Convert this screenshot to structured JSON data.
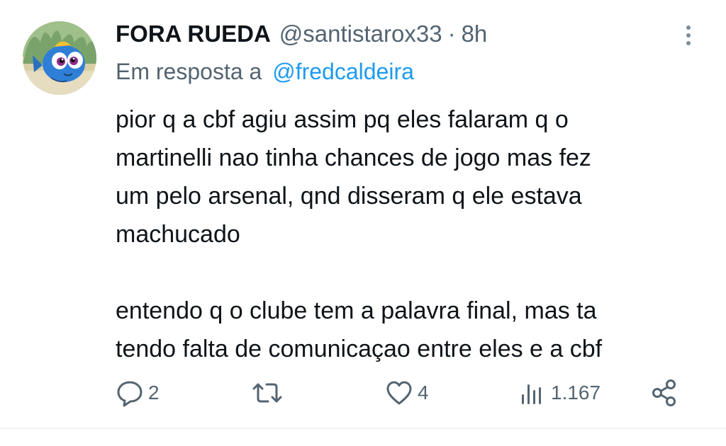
{
  "tweet": {
    "display_name": "FORA RUEDA",
    "handle": "@santistarox33",
    "separator": "·",
    "time": "8h",
    "reply_prefix": "Em resposta a",
    "reply_to": "@fredcaldeira",
    "body_lines": [
      "pior q a cbf agiu assim pq eles falaram q o",
      "martinelli nao tinha chances de jogo mas fez",
      "um pelo arsenal, qnd disseram q ele estava",
      "machucado",
      "entendo q o clube tem a palavra final, mas ta",
      "tendo falta de comunicaçao entre eles e a cbf"
    ],
    "avatar_icon": "cartoon-blue-fish-avatar",
    "more_icon": "more-vertical-icon"
  },
  "actions": {
    "reply": {
      "icon": "reply-icon",
      "count": "2"
    },
    "retweet": {
      "icon": "retweet-icon",
      "count": ""
    },
    "like": {
      "icon": "heart-icon",
      "count": "4"
    },
    "views": {
      "icon": "views-chart-icon",
      "count": "1.167"
    },
    "share": {
      "icon": "share-icon"
    }
  },
  "colors": {
    "text_primary": "#0f1419",
    "text_secondary": "#536471",
    "link": "#1d9bf0",
    "divider": "#eff3f4"
  }
}
